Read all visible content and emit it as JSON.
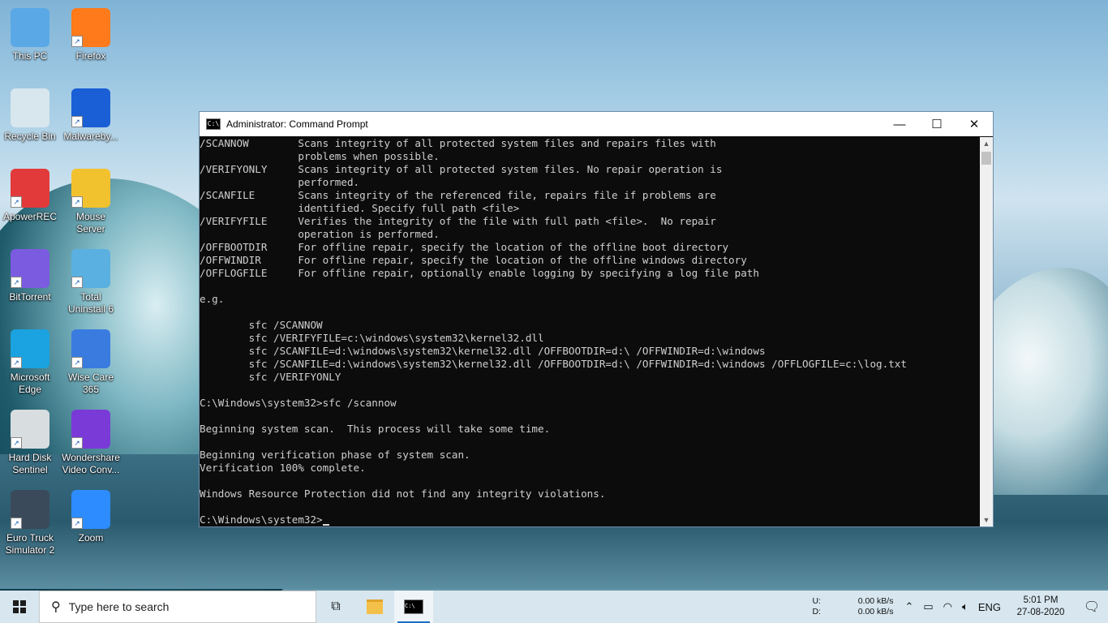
{
  "desktop": {
    "icons": [
      {
        "label": "This PC",
        "col": 0,
        "row": 0,
        "color": "#5aa9e6",
        "icon": "computer-icon",
        "shortcut": false
      },
      {
        "label": "Firefox",
        "col": 1,
        "row": 0,
        "color": "#ff7a1a",
        "icon": "firefox-icon",
        "shortcut": true
      },
      {
        "label": "Recycle Bin",
        "col": 0,
        "row": 1,
        "color": "#d8e6ee",
        "icon": "recycle-bin-icon",
        "shortcut": false
      },
      {
        "label": "Malwareby...",
        "col": 1,
        "row": 1,
        "color": "#1a5fd6",
        "icon": "malwarebytes-icon",
        "shortcut": true
      },
      {
        "label": "ApowerREC",
        "col": 0,
        "row": 2,
        "color": "#e23a3a",
        "icon": "apowerrec-icon",
        "shortcut": true
      },
      {
        "label": "Mouse Server",
        "col": 1,
        "row": 2,
        "color": "#f2c12e",
        "icon": "mouse-server-icon",
        "shortcut": true
      },
      {
        "label": "BitTorrent",
        "col": 0,
        "row": 3,
        "color": "#7b5be0",
        "icon": "bittorrent-icon",
        "shortcut": true
      },
      {
        "label": "Total Uninstall 6",
        "col": 1,
        "row": 3,
        "color": "#5ab0e0",
        "icon": "total-uninstall-icon",
        "shortcut": true
      },
      {
        "label": "Microsoft Edge",
        "col": 0,
        "row": 4,
        "color": "#1aa3e0",
        "icon": "edge-icon",
        "shortcut": true
      },
      {
        "label": "Wise Care 365",
        "col": 1,
        "row": 4,
        "color": "#3a7be0",
        "icon": "wise-care-icon",
        "shortcut": true
      },
      {
        "label": "Hard Disk Sentinel",
        "col": 0,
        "row": 5,
        "color": "#d8dde0",
        "icon": "hard-disk-icon",
        "shortcut": true
      },
      {
        "label": "Wondershare Video Conv...",
        "col": 1,
        "row": 5,
        "color": "#7a3ad8",
        "icon": "wondershare-icon",
        "shortcut": true
      },
      {
        "label": "Euro Truck Simulator 2",
        "col": 0,
        "row": 6,
        "color": "#3a4a5a",
        "icon": "truck-icon",
        "shortcut": true
      },
      {
        "label": "Zoom",
        "col": 1,
        "row": 6,
        "color": "#2d8cff",
        "icon": "zoom-icon",
        "shortcut": true
      }
    ]
  },
  "window": {
    "title": "Administrator: Command Prompt",
    "icon_text": "C:\\",
    "minimize": "—",
    "maximize": "☐",
    "close": "✕",
    "lines": [
      "/SCANNOW        Scans integrity of all protected system files and repairs files with",
      "                problems when possible.",
      "/VERIFYONLY     Scans integrity of all protected system files. No repair operation is",
      "                performed.",
      "/SCANFILE       Scans integrity of the referenced file, repairs file if problems are",
      "                identified. Specify full path <file>",
      "/VERIFYFILE     Verifies the integrity of the file with full path <file>.  No repair",
      "                operation is performed.",
      "/OFFBOOTDIR     For offline repair, specify the location of the offline boot directory",
      "/OFFWINDIR      For offline repair, specify the location of the offline windows directory",
      "/OFFLOGFILE     For offline repair, optionally enable logging by specifying a log file path",
      "",
      "e.g.",
      "",
      "        sfc /SCANNOW",
      "        sfc /VERIFYFILE=c:\\windows\\system32\\kernel32.dll",
      "        sfc /SCANFILE=d:\\windows\\system32\\kernel32.dll /OFFBOOTDIR=d:\\ /OFFWINDIR=d:\\windows",
      "        sfc /SCANFILE=d:\\windows\\system32\\kernel32.dll /OFFBOOTDIR=d:\\ /OFFWINDIR=d:\\windows /OFFLOGFILE=c:\\log.txt",
      "        sfc /VERIFYONLY",
      "",
      "C:\\Windows\\system32>sfc /scannow",
      "",
      "Beginning system scan.  This process will take some time.",
      "",
      "Beginning verification phase of system scan.",
      "Verification 100% complete.",
      "",
      "Windows Resource Protection did not find any integrity violations.",
      ""
    ],
    "prompt": "C:\\Windows\\system32>"
  },
  "taskbar": {
    "search_placeholder": "Type here to search",
    "net_up_label": "U:",
    "net_down_label": "D:",
    "net_up_value": "0.00 kB/s",
    "net_down_value": "0.00 kB/s",
    "language": "ENG",
    "time": "5:01 PM",
    "date": "27-08-2020"
  }
}
